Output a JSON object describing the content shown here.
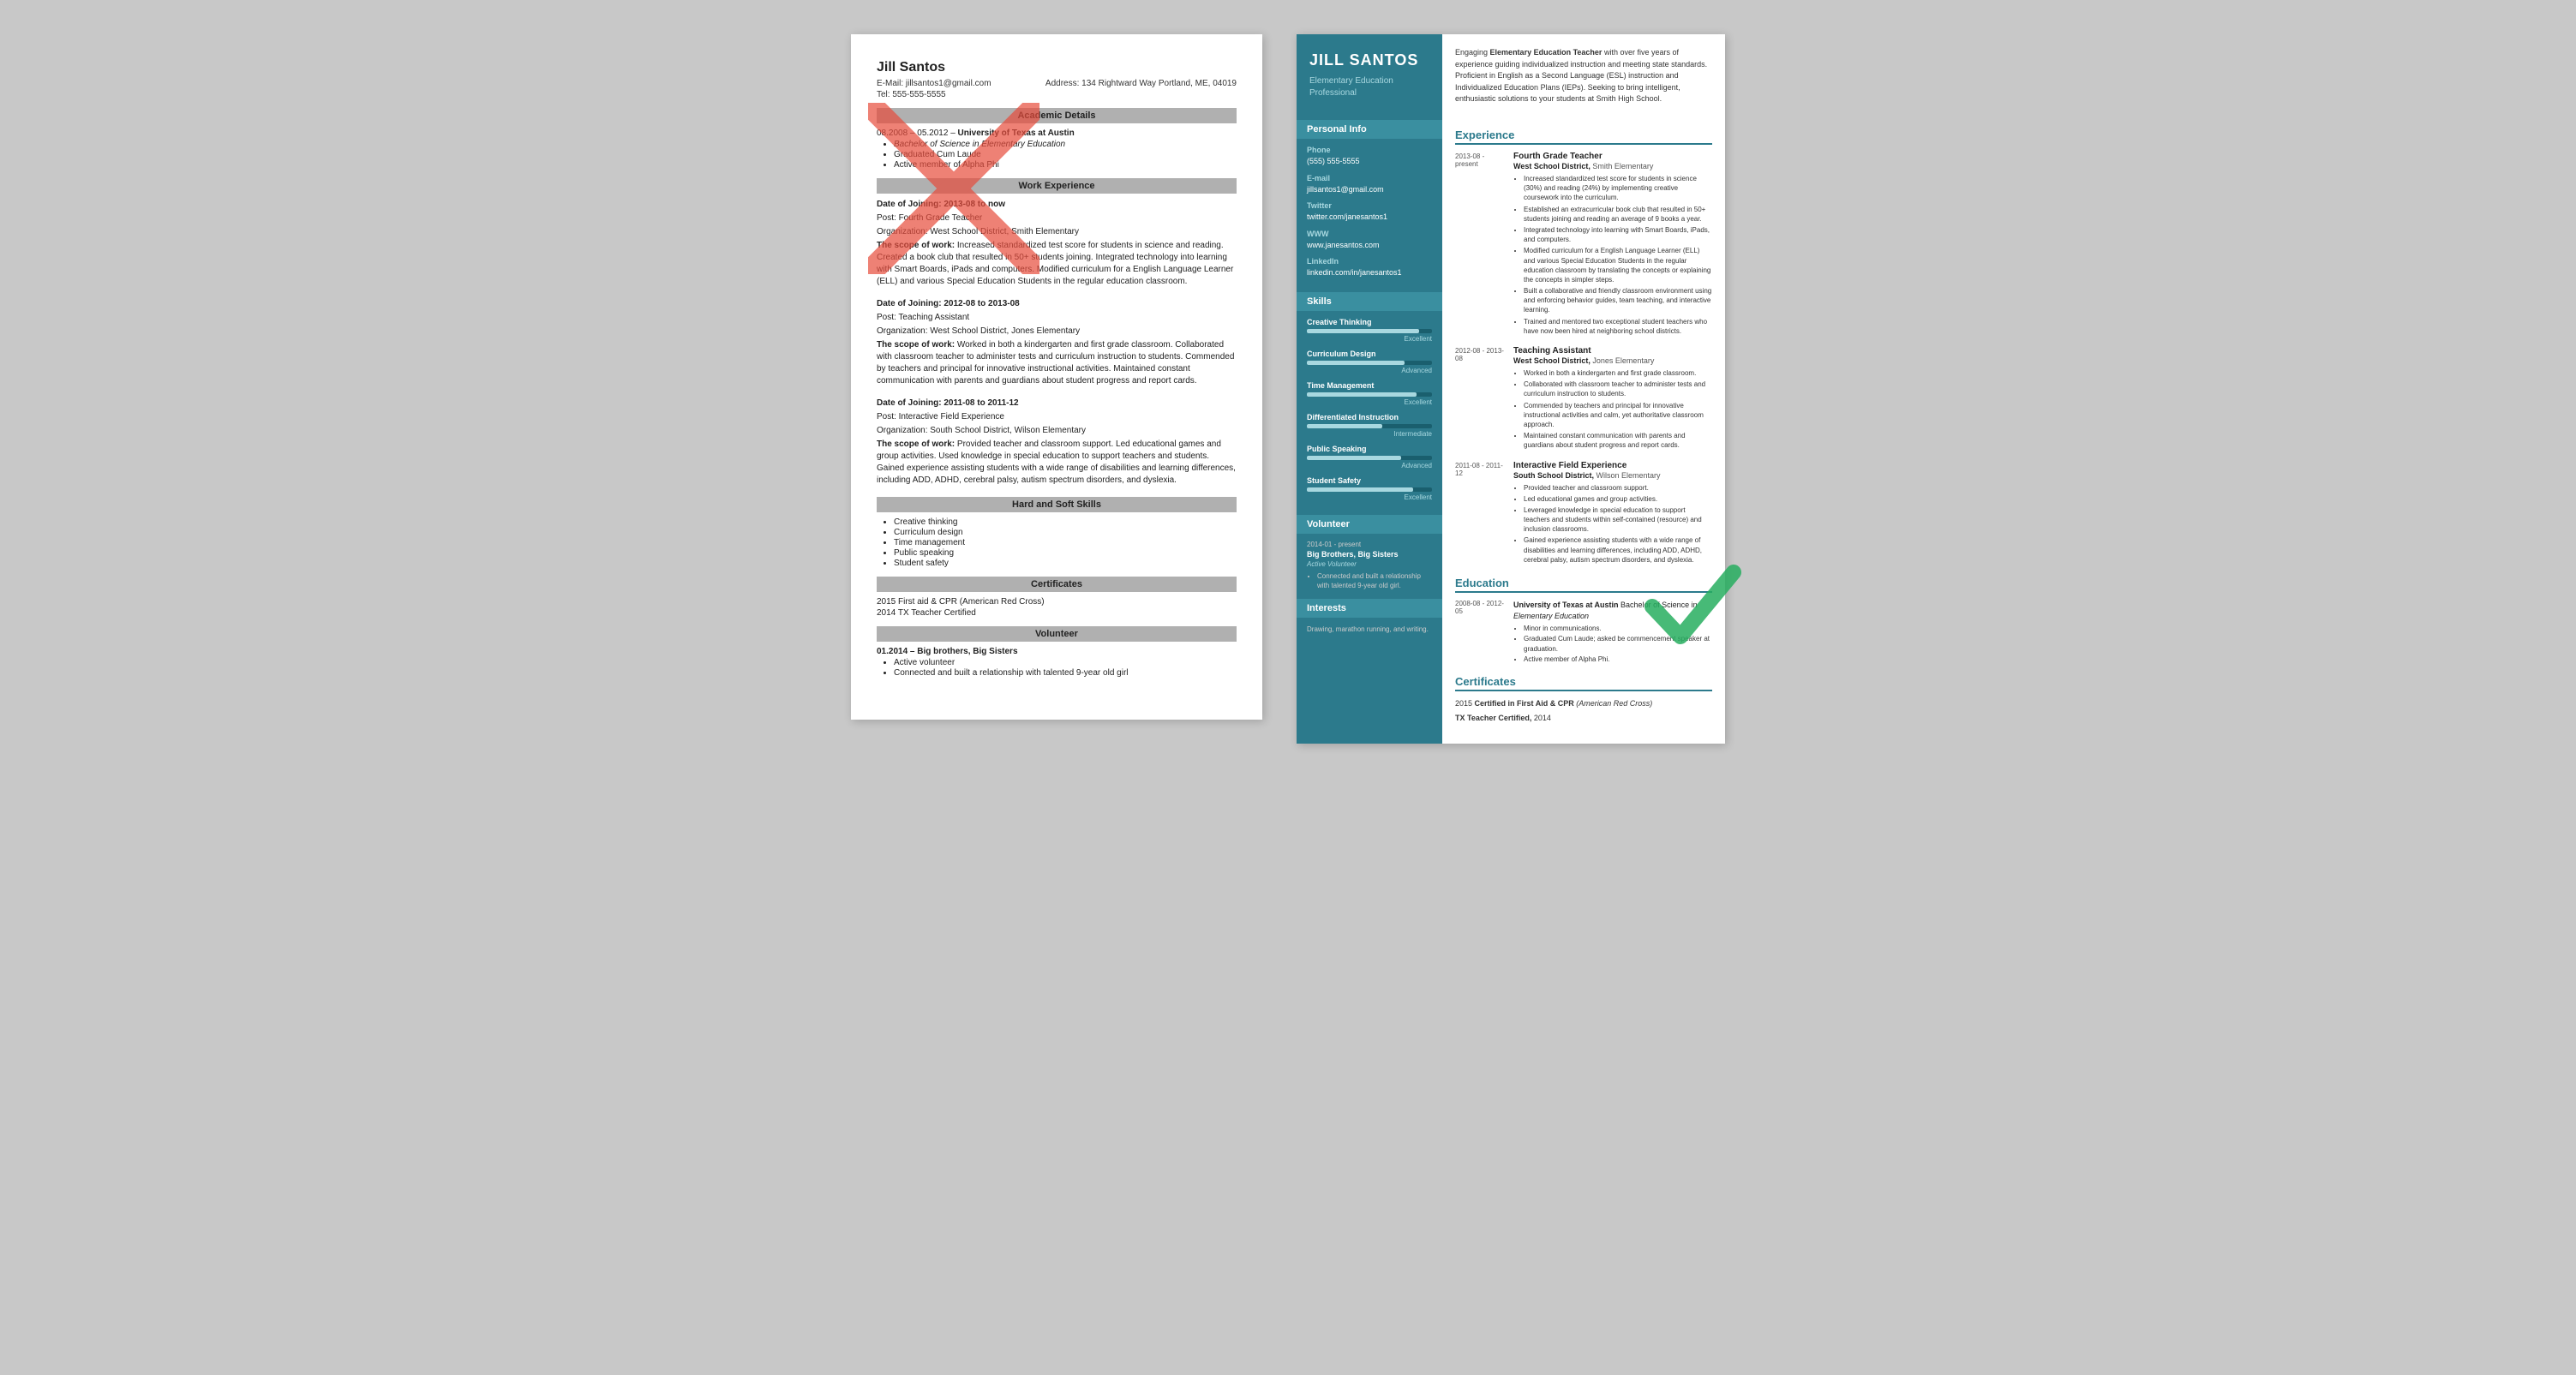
{
  "left": {
    "name": "Jill Santos",
    "email": "E-Mail: jillsantos1@gmail.com",
    "address": "Address: 134 Rightward Way Portland, ME, 04019",
    "tel": "Tel: 555-555-5555",
    "sections": {
      "academic_title": "Academic Details",
      "academic_date": "08.2008 – 05.2012 –",
      "academic_univ": "University of Texas at Austin",
      "academic_degree": "Bachelor of Science in Elementary Education",
      "academic_bullets": [
        "Graduated Cum Laude",
        "Active member of Alpha Phi"
      ],
      "work_title": "Work Experience",
      "work_entries": [
        {
          "date": "Date of Joining: 2013-08 to now",
          "post": "Post: Fourth Grade Teacher",
          "org": "Organization: West School District, Smith Elementary",
          "scope_label": "The scope of work:",
          "scope_text": "Increased standardized test score for students in science and reading. Created a book club that resulted in 50+ students joining. Integrated technology into learning with Smart Boards, iPads and computers. Modified curriculum for a English Language Learner (ELL) and various Special Education Students in the regular education classroom."
        },
        {
          "date": "Date of Joining: 2012-08 to 2013-08",
          "post": "Post: Teaching Assistant",
          "org": "Organization: West School District, Jones Elementary",
          "scope_label": "The scope of work:",
          "scope_text": "Worked in both a kindergarten and first grade classroom. Collaborated with classroom teacher to administer tests and curriculum instruction to students. Commended by teachers and principal for innovative instructional activities. Maintained constant communication with parents and guardians about student progress and report cards."
        },
        {
          "date": "Date of Joining: 2011-08 to 2011-12",
          "post": "Post: Interactive Field Experience",
          "org": "Organization: South School District, Wilson Elementary",
          "scope_label": "The scope of work:",
          "scope_text": "Provided teacher and classroom support. Led educational games and group activities. Used knowledge in special education to support teachers and students. Gained experience assisting students with a wide range of disabilities and learning differences, including ADD, ADHD, cerebral palsy, autism spectrum disorders, and dyslexia."
        }
      ],
      "hard_soft_title": "Hard and Soft Skills",
      "skills": [
        "Creative thinking",
        "Curriculum design",
        "Time management",
        "Public speaking",
        "Student safety"
      ],
      "cert_title": "Certificates",
      "certs": [
        "2015 First aid & CPR (American Red Cross)",
        "2014 TX Teacher Certified"
      ],
      "vol_title": "Volunteer",
      "vol_date": "01.2014 – Big brothers, Big Sisters",
      "vol_bullets": [
        "Active volunteer",
        "Connected and built a relationship with talented 9-year old girl"
      ]
    }
  },
  "right": {
    "header": {
      "name": "JILL SANTOS",
      "subtitle": "Elementary Education Professional",
      "summary": "Engaging Elementary Education Teacher with over five years of experience guiding individualized instruction and meeting state standards. Proficient in English as a Second Language (ESL) instruction and Individualized Education Plans (IEPs). Seeking to bring intelligent, enthusiastic solutions to your students at Smith High School."
    },
    "personal_info": {
      "section_title": "Personal Info",
      "phone_label": "Phone",
      "phone": "(555) 555-5555",
      "email_label": "E-mail",
      "email": "jillsantos1@gmail.com",
      "twitter_label": "Twitter",
      "twitter": "twitter.com/janesantos1",
      "www_label": "WWW",
      "www": "www.janesantos.com",
      "linkedin_label": "LinkedIn",
      "linkedin": "linkedin.com/in/janesantos1"
    },
    "skills": {
      "section_title": "Skills",
      "items": [
        {
          "name": "Creative Thinking",
          "level": "Excellent",
          "pct": 90
        },
        {
          "name": "Curriculum Design",
          "level": "Advanced",
          "pct": 78
        },
        {
          "name": "Time Management",
          "level": "Excellent",
          "pct": 88
        },
        {
          "name": "Differentiated Instruction",
          "level": "Intermediate",
          "pct": 60
        },
        {
          "name": "Public Speaking",
          "level": "Advanced",
          "pct": 75
        },
        {
          "name": "Student Safety",
          "level": "Excellent",
          "pct": 85
        }
      ]
    },
    "volunteer": {
      "section_title": "Volunteer",
      "date": "2014-01 - present",
      "org": "Big Brothers, Big Sisters",
      "role": "Active Volunteer",
      "bullets": [
        "Connected and built a relationship with talented 9-year old girl."
      ]
    },
    "interests": {
      "section_title": "Interests",
      "text": "Drawing, marathon running, and writing."
    },
    "experience": {
      "section_title": "Experience",
      "entries": [
        {
          "date": "2013-08 - present",
          "title": "Fourth Grade Teacher",
          "org": "West School District,",
          "org2": "Smith Elementary",
          "bullets": [
            "Increased standardized test score for students in science (30%) and reading (24%) by implementing creative coursework into the curriculum.",
            "Established an extracurricular book club that resulted in 50+ students joining and reading an average of 9 books a year.",
            "Integrated technology into learning with Smart Boards, iPads, and computers.",
            "Modified curriculum for a English Language Learner (ELL) and various Special Education Students in the regular education classroom by translating the concepts or explaining the concepts in simpler steps.",
            "Built a collaborative and friendly classroom environment using and enforcing behavior guides, team teaching, and interactive learning.",
            "Trained and mentored two exceptional student teachers who have now been hired at neighboring school districts."
          ]
        },
        {
          "date": "2012-08 - 2013-08",
          "title": "Teaching Assistant",
          "org": "West School District,",
          "org2": "Jones Elementary",
          "bullets": [
            "Worked in both a kindergarten and first grade classroom.",
            "Collaborated with classroom teacher to administer tests and curriculum instruction to students.",
            "Commended by teachers and principal for innovative instructional activities and calm, yet authoritative classroom approach.",
            "Maintained constant communication with parents and guardians about student progress and report cards."
          ]
        },
        {
          "date": "2011-08 - 2011-12",
          "title": "Interactive Field Experience",
          "org": "South School District,",
          "org2": "Wilson Elementary",
          "bullets": [
            "Provided teacher and classroom support.",
            "Led educational games and group activities.",
            "Leveraged knowledge in special education to support teachers and students within self-contained (resource) and inclusion classrooms.",
            "Gained experience assisting students with a wide range of disabilities and learning differences, including ADD, ADHD, cerebral palsy, autism spectrum disorders, and dyslexia."
          ]
        }
      ]
    },
    "education": {
      "section_title": "Education",
      "entries": [
        {
          "date": "2008-08 - 2012-05",
          "main": "University of Texas at Austin Bachelor of Science in Elementary Education",
          "bullets": [
            "Minor in communications.",
            "Graduated Cum Laude; asked be commencement speaker at graduation.",
            "Active member of Alpha Phi."
          ]
        }
      ]
    },
    "certificates": {
      "section_title": "Certificates",
      "items": [
        {
          "year": "2015",
          "name": "Certified in First Aid & CPR",
          "extra": "(American Red Cross)"
        },
        {
          "name": "TX Teacher Certified,",
          "year2": "2014"
        }
      ]
    }
  }
}
